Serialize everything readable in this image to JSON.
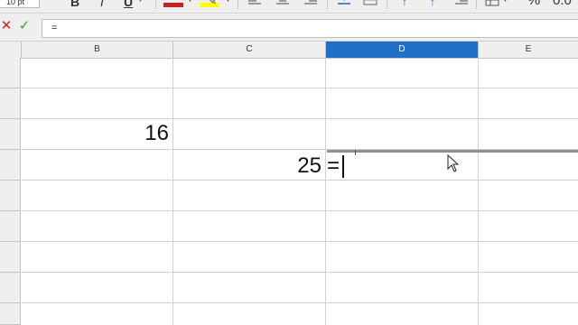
{
  "toolbar": {
    "font_size": "10 pt",
    "bold": "B",
    "italic": "I",
    "underline": "U",
    "percent": "%",
    "decimal": "0.0",
    "colors": {
      "font_color": "#c9211e",
      "highlight_color": "#ffff00"
    }
  },
  "formula_bar": {
    "cancel_icon": "✕",
    "accept_icon": "✓",
    "content": "="
  },
  "grid": {
    "columns": [
      "B",
      "C",
      "D",
      "E"
    ],
    "active_column": "D",
    "active_color": "#1f6fc8",
    "cells": {
      "B4": "16",
      "C5": "25"
    },
    "editing_cell": "D5",
    "editing_content": "="
  }
}
